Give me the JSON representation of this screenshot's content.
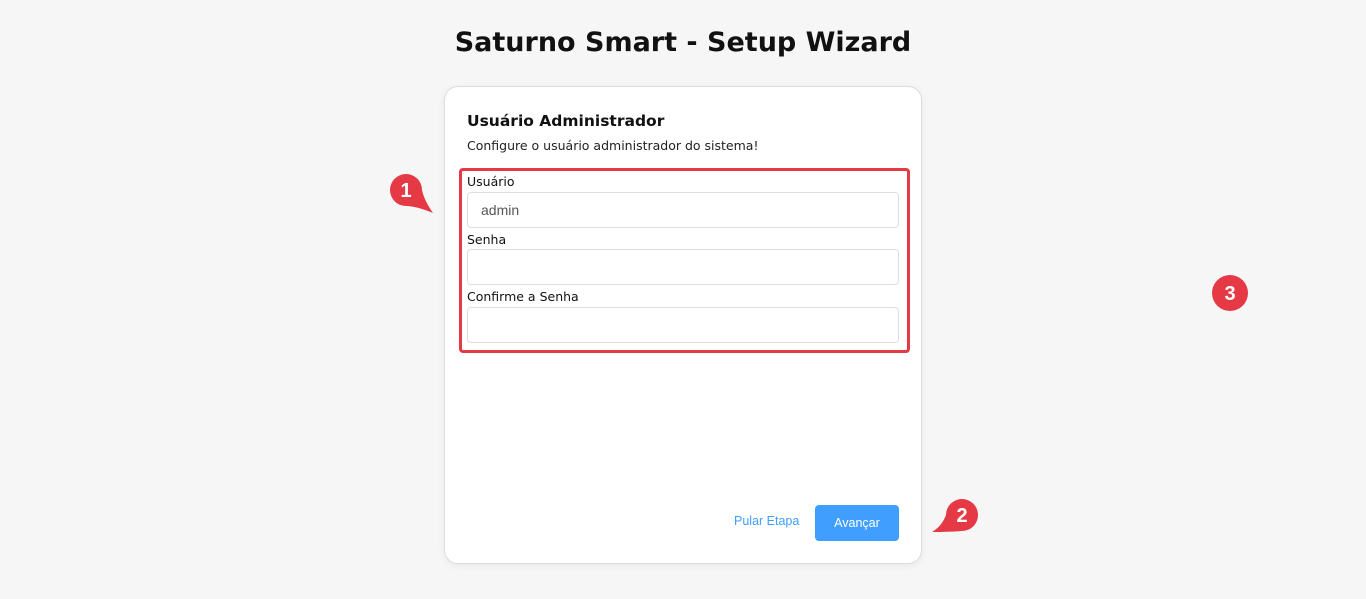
{
  "header": {
    "title": "Saturno Smart - Setup Wizard"
  },
  "step": {
    "title": "Usuário Administrador",
    "description": "Configure o usuário administrador do sistema!"
  },
  "form": {
    "username": {
      "label": "Usuário",
      "value": "admin"
    },
    "password": {
      "label": "Senha",
      "value": ""
    },
    "confirm_password": {
      "label": "Confirme a Senha",
      "value": ""
    }
  },
  "actions": {
    "skip_label": "Pular Etapa",
    "next_label": "Avançar"
  },
  "callouts": [
    "1",
    "2",
    "3"
  ],
  "colors": {
    "accent": "#409eff",
    "callout": "#e53946",
    "background": "#f6f6f6"
  }
}
